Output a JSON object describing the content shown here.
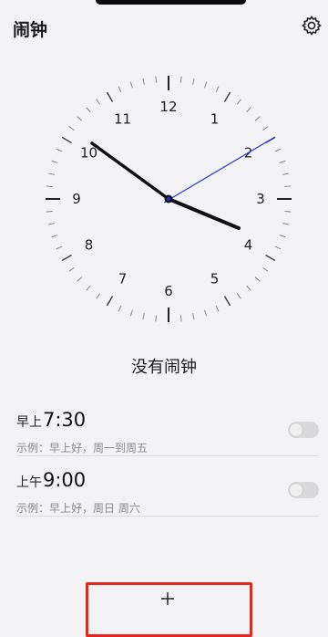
{
  "header": {
    "title": "闹钟",
    "settings_icon": "gear-icon"
  },
  "clock": {
    "numbers": [
      "12",
      "1",
      "2",
      "3",
      "4",
      "5",
      "6",
      "7",
      "8",
      "9",
      "10",
      "11"
    ],
    "hour_hand_color": "#111111",
    "second_hand_color": "#2a2fd6"
  },
  "empty_state": {
    "text": "没有闹钟"
  },
  "alarms": [
    {
      "period": "早上",
      "time": "7:30",
      "subtitle": "示例：早上好，周一到周五",
      "enabled": false
    },
    {
      "period": "上午",
      "time": "9:00",
      "subtitle": "示例：早上好，周日 周六",
      "enabled": false
    }
  ],
  "footer": {
    "add_button_icon": "plus-icon",
    "highlight_color": "#e8261a"
  }
}
